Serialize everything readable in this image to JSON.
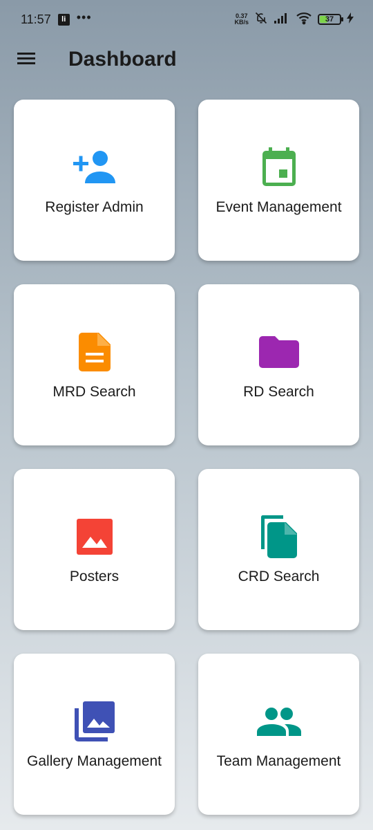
{
  "status": {
    "time": "11:57",
    "app_icon": "li",
    "overflow": "•••",
    "speed_value": "0.37",
    "speed_unit": "KB/s",
    "battery": "37",
    "battery_level": 0.37
  },
  "app_bar": {
    "title": "Dashboard"
  },
  "cards": [
    {
      "label": "Register Admin",
      "icon": "person-add-icon",
      "color": "#2196f3"
    },
    {
      "label": "Event Management",
      "icon": "calendar-event-icon",
      "color": "#4caf50"
    },
    {
      "label": "MRD Search",
      "icon": "document-icon",
      "color": "#fb8c00"
    },
    {
      "label": "RD Search",
      "icon": "folder-icon",
      "color": "#9c27b0"
    },
    {
      "label": "Posters",
      "icon": "image-icon",
      "color": "#f44336"
    },
    {
      "label": "CRD Search",
      "icon": "file-copy-icon",
      "color": "#009688"
    },
    {
      "label": "Gallery Management",
      "icon": "photo-library-icon",
      "color": "#3f51b5"
    },
    {
      "label": "Team Management",
      "icon": "group-icon",
      "color": "#009688"
    }
  ]
}
